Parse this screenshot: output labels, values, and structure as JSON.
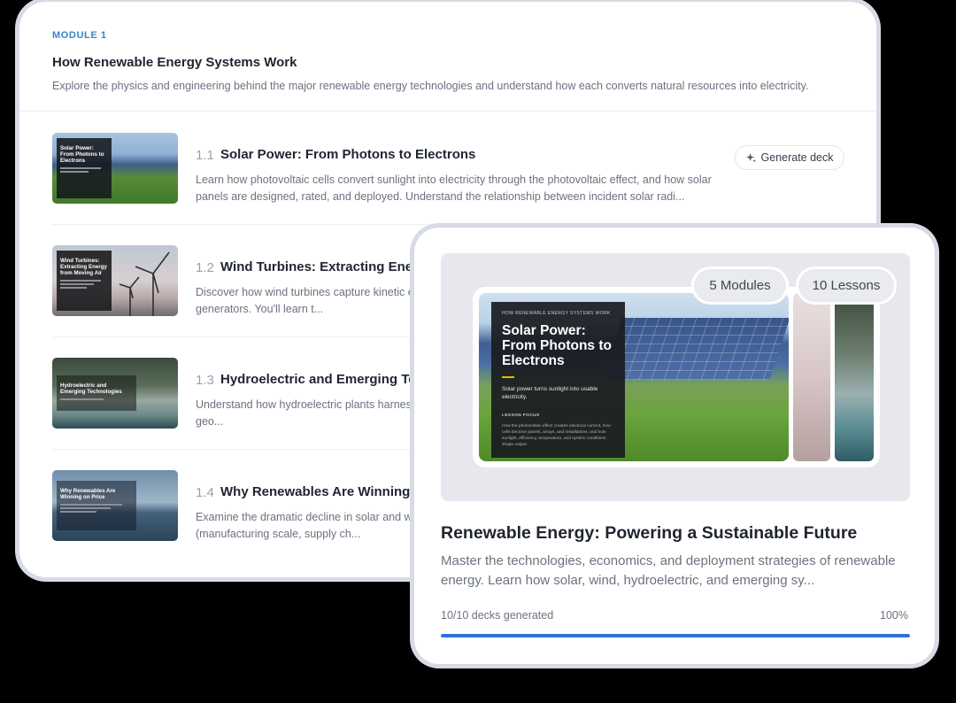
{
  "module": {
    "eyebrow": "MODULE 1",
    "title": "How Renewable Energy Systems Work",
    "description": "Explore the physics and engineering behind the major renewable energy technologies and understand how each converts natural resources into electricity.",
    "generate_label": "Generate deck",
    "lessons": [
      {
        "number": "1.1",
        "title": "Solar Power: From Photons to Electrons",
        "description": "Learn how photovoltaic cells convert sunlight into electricity through the photovoltaic effect, and how solar panels are designed, rated, and deployed. Understand the relationship between incident solar radi...",
        "thumb_title": "Solar Power: From Photons to Electrons"
      },
      {
        "number": "1.2",
        "title": "Wind Turbines: Extracting Energy from Moving Air",
        "description": "Discover how wind turbines capture kinetic energy from moving air and convert it into electricity through generators. You'll learn t...",
        "thumb_title": "Wind Turbines: Extracting Energy from Moving Air"
      },
      {
        "number": "1.3",
        "title": "Hydroelectric and Emerging Technologies",
        "description": "Understand how hydroelectric plants harness falling water to provide dispatchable power. Then explore how geo...",
        "thumb_title": "Hydroelectric and Emerging Technologies"
      },
      {
        "number": "1.4",
        "title": "Why Renewables Are Winning on Price",
        "description": "Examine the dramatic decline in solar and wind costs and the drivers behind these reductions (manufacturing scale, supply ch...",
        "thumb_title": "Why Renewables Are Winning on Price"
      }
    ]
  },
  "course": {
    "modules_badge": "5 Modules",
    "lessons_badge": "10 Lessons",
    "slide": {
      "eyebrow": "HOW RENEWABLE ENERGY SYSTEMS WORK",
      "title": "Solar Power: From Photons to Electrons",
      "subtitle": "Solar power turns sunlight into usable electricity.",
      "focus_label": "LESSON FOCUS",
      "focus_text": "How the photovoltaic effect creates electrical current, how cells become panels, arrays, and installations, and how sunlight, efficiency, temperature, and system conditions shape output."
    },
    "title": "Renewable Energy: Powering a Sustainable Future",
    "description": "Master the technologies, economics, and deployment strategies of renewable energy. Learn how solar, wind, hydroelectric, and emerging sy...",
    "progress_label": "10/10 decks generated",
    "progress_percent": "100%",
    "progress_fraction": 1.0
  },
  "colors": {
    "accent": "#2f6fdc",
    "eyebrow": "#3b82c8"
  }
}
